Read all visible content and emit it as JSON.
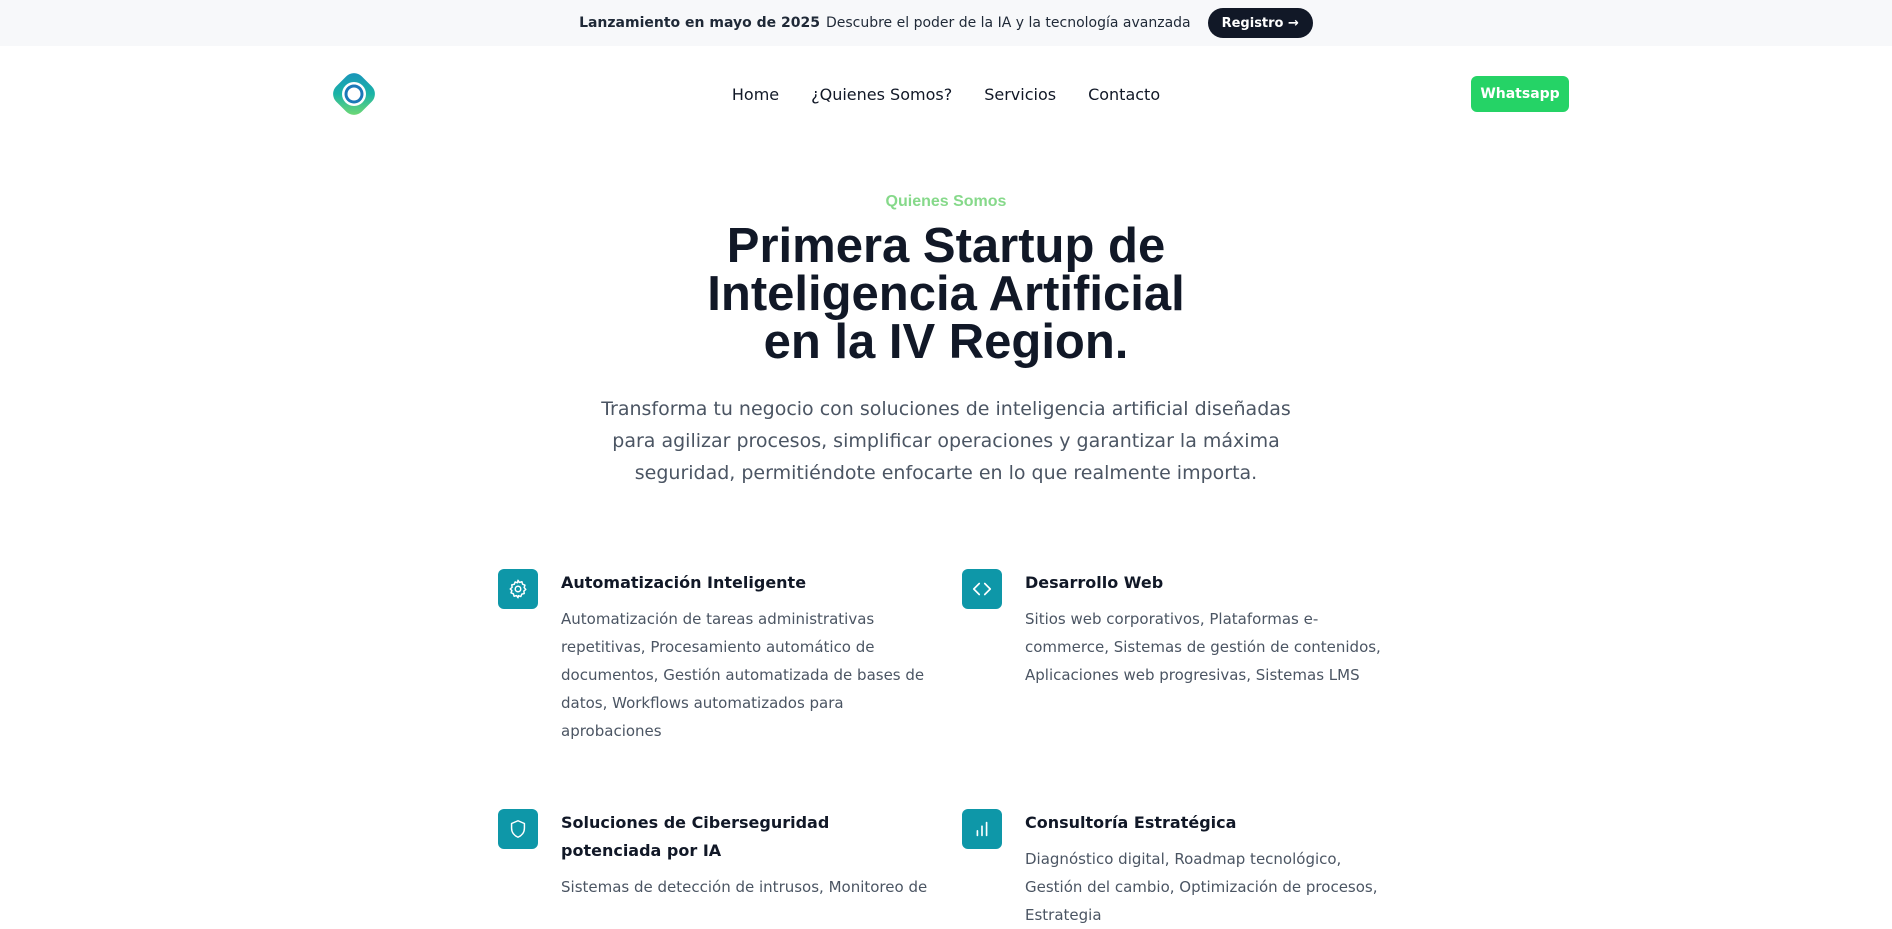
{
  "announcement": {
    "strong": "Lanzamiento en mayo de 2025",
    "text": "Descubre el poder de la IA y la tecnología avanzada",
    "button": "Registro →"
  },
  "nav": {
    "items": [
      "Home",
      "¿Quienes Somos?",
      "Servicios",
      "Contacto"
    ],
    "whatsapp": "Whatsapp"
  },
  "hero": {
    "eyebrow": "Quienes Somos",
    "title_lines": [
      "Primera Startup de",
      "Inteligencia Artificial",
      "en la IV Region."
    ],
    "description": "Transforma tu negocio con soluciones de inteligencia artificial diseñadas para agilizar procesos, simplificar operaciones y garantizar la máxima seguridad, permitiéndote enfocarte en lo que realmente importa."
  },
  "features": [
    {
      "icon": "gear-icon",
      "title": "Automatización Inteligente",
      "description": "Automatización de tareas administrativas repetitivas, Procesamiento automático de documentos, Gestión automatizada de bases de datos, Workflows automatizados para aprobaciones"
    },
    {
      "icon": "code-icon",
      "title": "Desarrollo Web",
      "description": "Sitios web corporativos, Plataformas e-commerce, Sistemas de gestión de contenidos, Aplicaciones web progresivas, Sistemas LMS"
    },
    {
      "icon": "shield-icon",
      "title": "Soluciones de Ciberseguridad potenciada por IA",
      "description": "Sistemas de detección de intrusos, Monitoreo de"
    },
    {
      "icon": "bar-chart-icon",
      "title": "Consultoría Estratégica",
      "description": "Diagnóstico digital, Roadmap tecnológico, Gestión del cambio, Optimización de procesos, Estrategia"
    }
  ],
  "colors": {
    "accent": "#0e97a8",
    "whatsapp": "#25d366",
    "eyebrow": "#86d98a",
    "dark": "#111827"
  }
}
